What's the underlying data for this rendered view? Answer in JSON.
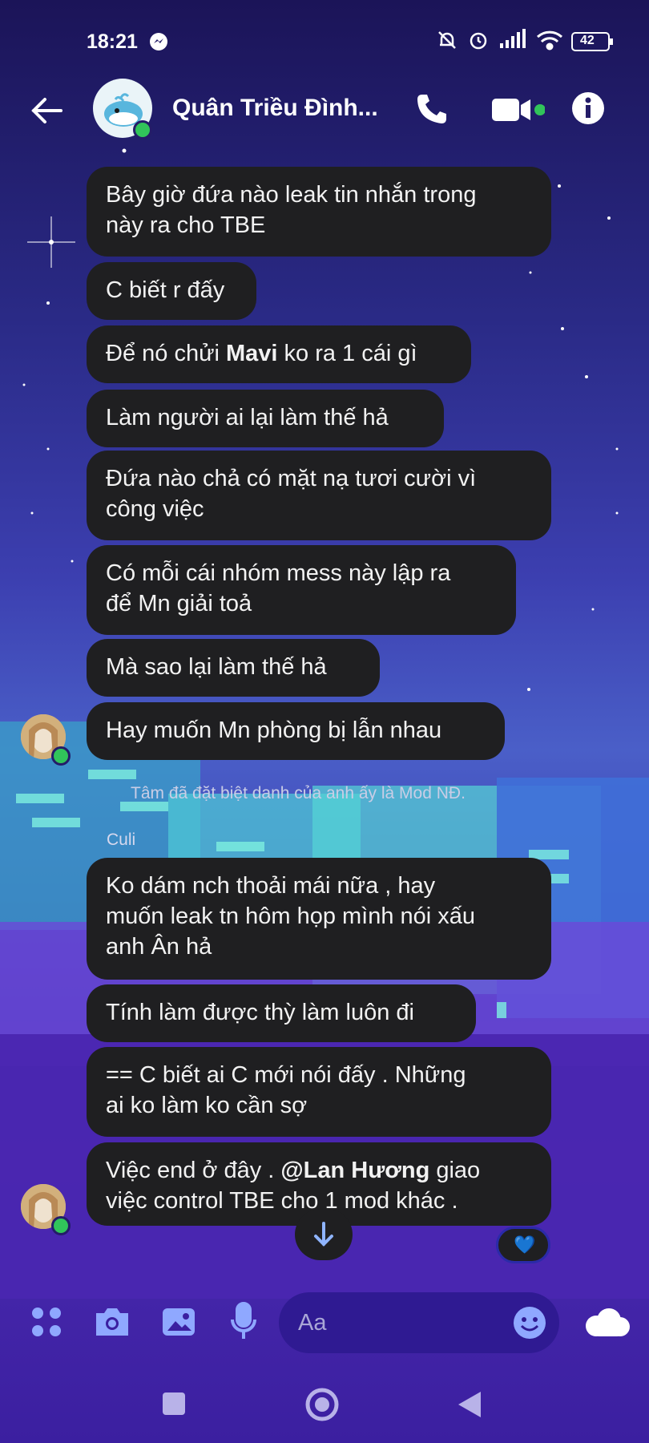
{
  "status_bar": {
    "time": "18:21",
    "battery": "42"
  },
  "header": {
    "title": "Quân Triều Đình..."
  },
  "messages": [
    {
      "lines": [
        "Bây giờ đứa nào leak tin nhắn trong",
        "này ra cho TBE"
      ]
    },
    {
      "lines": [
        "C biết r đấy"
      ]
    },
    {
      "pre": "Để nó chửi ",
      "bold": "Mavi",
      "post": " ko ra 1 cái gì"
    },
    {
      "lines": [
        "Làm người ai lại làm thế hả"
      ]
    },
    {
      "lines": [
        "Đứa nào chả có mặt nạ tươi cười vì",
        "công việc"
      ]
    },
    {
      "lines": [
        "Có mỗi cái nhóm mess này lập ra",
        "để Mn giải toả"
      ]
    },
    {
      "lines": [
        "Mà sao lại làm thế hả"
      ]
    },
    {
      "lines": [
        "Hay muốn Mn phòng bị lẫn nhau"
      ]
    },
    {
      "lines": [
        "Ko dám nch thoải mái nữa , hay",
        "muốn leak tn hôm họp mình nói xấu",
        "anh Ân hả"
      ]
    },
    {
      "lines": [
        "Tính làm được thỳ làm luôn đi"
      ]
    },
    {
      "lines": [
        "== C biết ai C mới nói đấy . Những",
        "ai ko làm ko cần sợ"
      ]
    },
    {
      "line1_pre": "Việc end ở đây . ",
      "mention": "@Lan Hương",
      "line1_post": " giao",
      "line2": "việc control TBE cho 1 mod khác ."
    }
  ],
  "system_note": "Tâm đã đặt biệt danh của anh ấy là Mod NĐ.",
  "sender_name": "Culi",
  "reaction": "💙",
  "composer": {
    "placeholder": "Aa"
  },
  "colors": {
    "bubble": "#1f1f21",
    "online": "#31c45a",
    "accent": "#2f1a92"
  }
}
